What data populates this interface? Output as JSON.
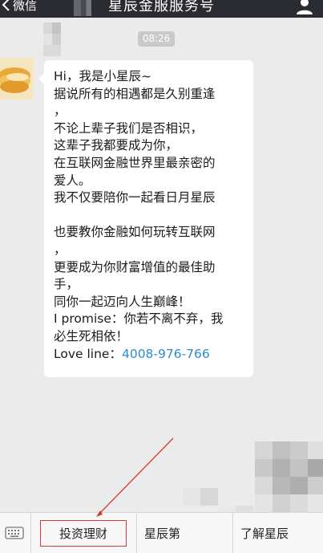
{
  "navbar": {
    "back_label": "微信",
    "title": "星辰金服服务号"
  },
  "chat": {
    "timestamp": "08:26",
    "message": {
      "lines": [
        "Hi，我是小星辰~",
        "据说所有的相遇都是久别重逢",
        "，",
        "不论上辈子我们是否相识，",
        "这辈子我都要成为你，",
        "在互联网金融世界里最亲密的",
        "爱人。",
        "我不仅要陪你一起看日月星辰",
        "",
        "也要教你金融如何玩转互联网",
        "，",
        "更要成为你财富增值的最佳助",
        "手，",
        "同你一起迈向人生巅峰！",
        "I promise：你若不离不弃，我",
        "必生死相依！"
      ],
      "last_line_prefix": "Love line：",
      "phone": "4008-976-766"
    }
  },
  "menu": {
    "items": [
      {
        "label": "投资理财"
      },
      {
        "label": "星辰第"
      },
      {
        "label": "了解星辰"
      }
    ]
  },
  "colors": {
    "navbar_bg": "#2a2c31",
    "chat_bg": "#ebebeb",
    "link_blue": "#2d8cd0",
    "annotation_red": "#d33a3a"
  },
  "icons": [
    "back-chevron-icon",
    "profile-icon",
    "keyboard-icon",
    "avatar-logo-icon"
  ]
}
